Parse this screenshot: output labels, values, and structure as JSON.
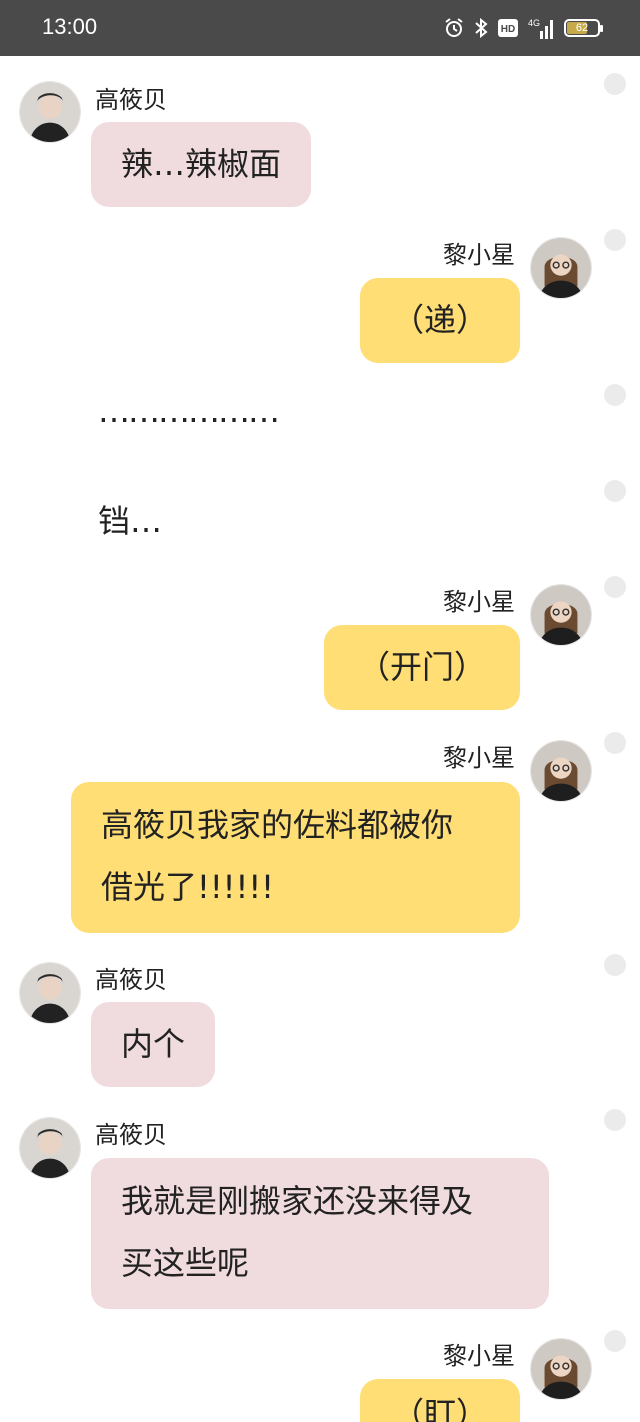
{
  "status_bar": {
    "time": "13:00",
    "battery": "62",
    "icons": [
      "alarm-icon",
      "bluetooth-icon",
      "hd-icon",
      "signal-4g-icon",
      "battery-icon"
    ]
  },
  "colors": {
    "left_bubble": "#f0dcde",
    "right_bubble": "#ffde75",
    "status_bar": "#4a4a4a"
  },
  "messages": [
    {
      "side": "left",
      "sender": "高筱贝",
      "text": "辣…辣椒面"
    },
    {
      "side": "right",
      "sender": "黎小星",
      "text": "（递）"
    },
    {
      "side": "plain",
      "text": "………………"
    },
    {
      "side": "plain",
      "text": "铛…"
    },
    {
      "side": "right",
      "sender": "黎小星",
      "text": "（开门）"
    },
    {
      "side": "right",
      "sender": "黎小星",
      "lines": [
        "高筱贝我家的佐料都被你",
        "借光了!!!!!!"
      ]
    },
    {
      "side": "left",
      "sender": "高筱贝",
      "text": "内个"
    },
    {
      "side": "left",
      "sender": "高筱贝",
      "lines": [
        "我就是刚搬家还没来得及",
        "买这些呢"
      ]
    },
    {
      "side": "right",
      "sender": "黎小星",
      "text": "（盯）"
    }
  ]
}
